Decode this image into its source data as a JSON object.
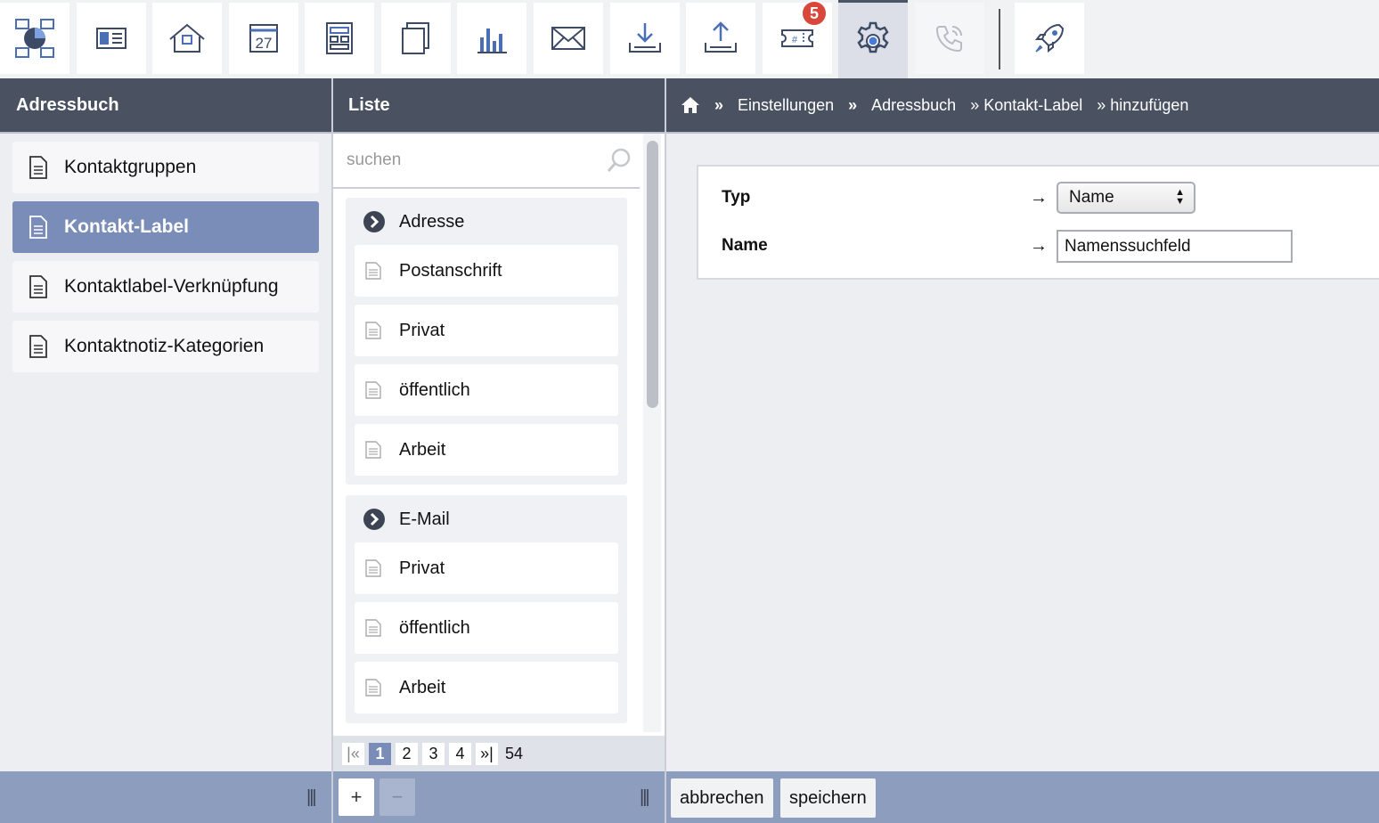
{
  "toolbar": {
    "items": [
      {
        "icon": "dashboard-icon"
      },
      {
        "icon": "address-card-icon"
      },
      {
        "icon": "home-icon"
      },
      {
        "icon": "calendar-icon",
        "label": "27"
      },
      {
        "icon": "layout-icon"
      },
      {
        "icon": "documents-icon"
      },
      {
        "icon": "bar-chart-icon"
      },
      {
        "icon": "mail-icon"
      },
      {
        "icon": "download-icon"
      },
      {
        "icon": "upload-icon"
      },
      {
        "icon": "ticket-icon",
        "badge": "5"
      },
      {
        "icon": "gear-icon",
        "active": true
      },
      {
        "icon": "phone-icon",
        "disabled": true
      },
      {
        "icon": "rocket-icon"
      }
    ]
  },
  "panels": {
    "left_title": "Adressbuch",
    "middle_title": "Liste"
  },
  "breadcrumb": {
    "sep": "»",
    "items": [
      "Einstellungen",
      "Adressbuch",
      "» Kontakt-Label",
      "» hinzufügen"
    ]
  },
  "sidebar": {
    "items": [
      {
        "label": "Kontaktgruppen"
      },
      {
        "label": "Kontakt-Label",
        "active": true
      },
      {
        "label": "Kontaktlabel-Verknüpfung"
      },
      {
        "label": "Kontaktnotiz-Kategorien"
      }
    ]
  },
  "search": {
    "placeholder": "suchen"
  },
  "list": {
    "groups": [
      {
        "title": "Adresse",
        "items": [
          "Postanschrift",
          "Privat",
          "öffentlich",
          "Arbeit"
        ]
      },
      {
        "title": "E-Mail",
        "items": [
          "Privat",
          "öffentlich",
          "Arbeit"
        ]
      }
    ]
  },
  "pager": {
    "first": "|«",
    "pages": [
      "1",
      "2",
      "3",
      "4"
    ],
    "last": "»|",
    "total": "54"
  },
  "form": {
    "type_label": "Typ",
    "type_value": "Name",
    "name_label": "Name",
    "name_value": "Namenssuchfeld",
    "arrow": "→"
  },
  "bottom": {
    "grip": "|||",
    "add": "+",
    "remove": "−",
    "cancel": "abbrechen",
    "save": "speichern"
  }
}
